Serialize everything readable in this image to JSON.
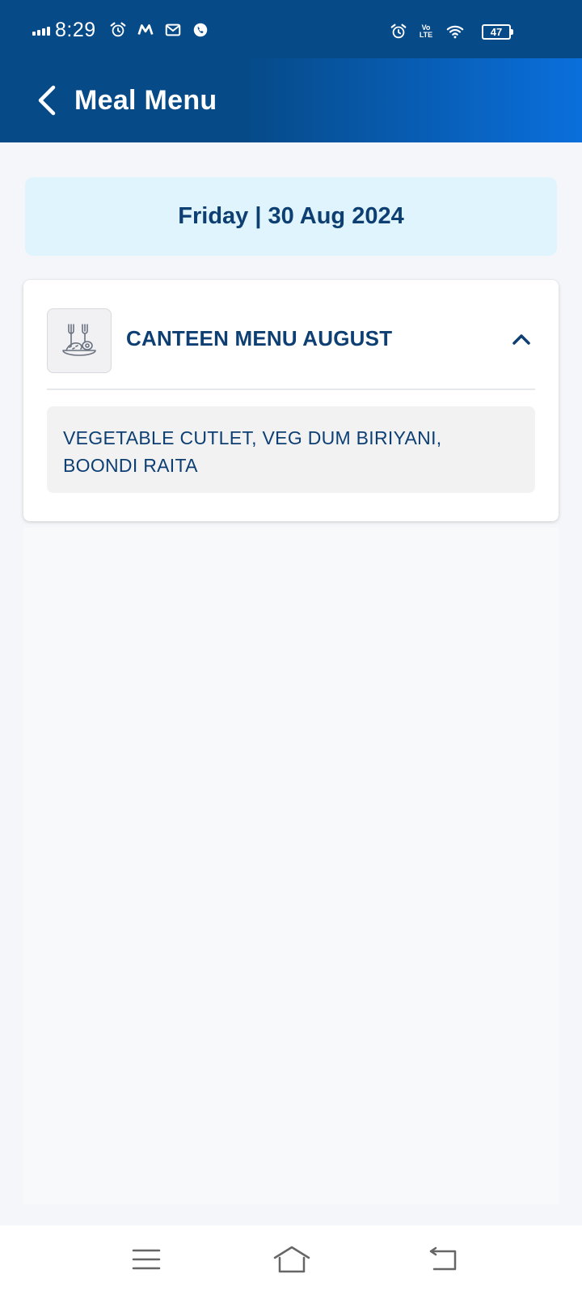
{
  "status_bar": {
    "time": "8:29",
    "volte_line1": "Vo",
    "volte_line2": "LTE",
    "battery": "47",
    "icons_left": [
      "signal-icon",
      "alarm-icon",
      "m-app-icon",
      "gmail-icon",
      "call-app-icon"
    ],
    "icons_right": [
      "alarm-icon",
      "volte-icon",
      "wifi-icon",
      "battery-icon"
    ]
  },
  "header": {
    "title": "Meal Menu",
    "back_icon": "chevron-left-icon"
  },
  "date_banner": {
    "text": "Friday | 30 Aug 2024"
  },
  "menu_card": {
    "icon": "plate-fork-icon",
    "title": "CANTEEN MENU AUGUST",
    "toggle_icon": "chevron-up-icon",
    "items_text_line1": "VEGETABLE CUTLET, VEG DUM BIRIYANI,",
    "items_text_line2": "BOONDI RAITA"
  },
  "nav_bar": {
    "icons": [
      "menu-icon",
      "home-icon",
      "back-icon"
    ]
  },
  "colors": {
    "header_start": "#064a88",
    "header_end": "#0a6fdc",
    "banner_bg": "#dff4fd",
    "text_primary": "#0d3f73"
  }
}
